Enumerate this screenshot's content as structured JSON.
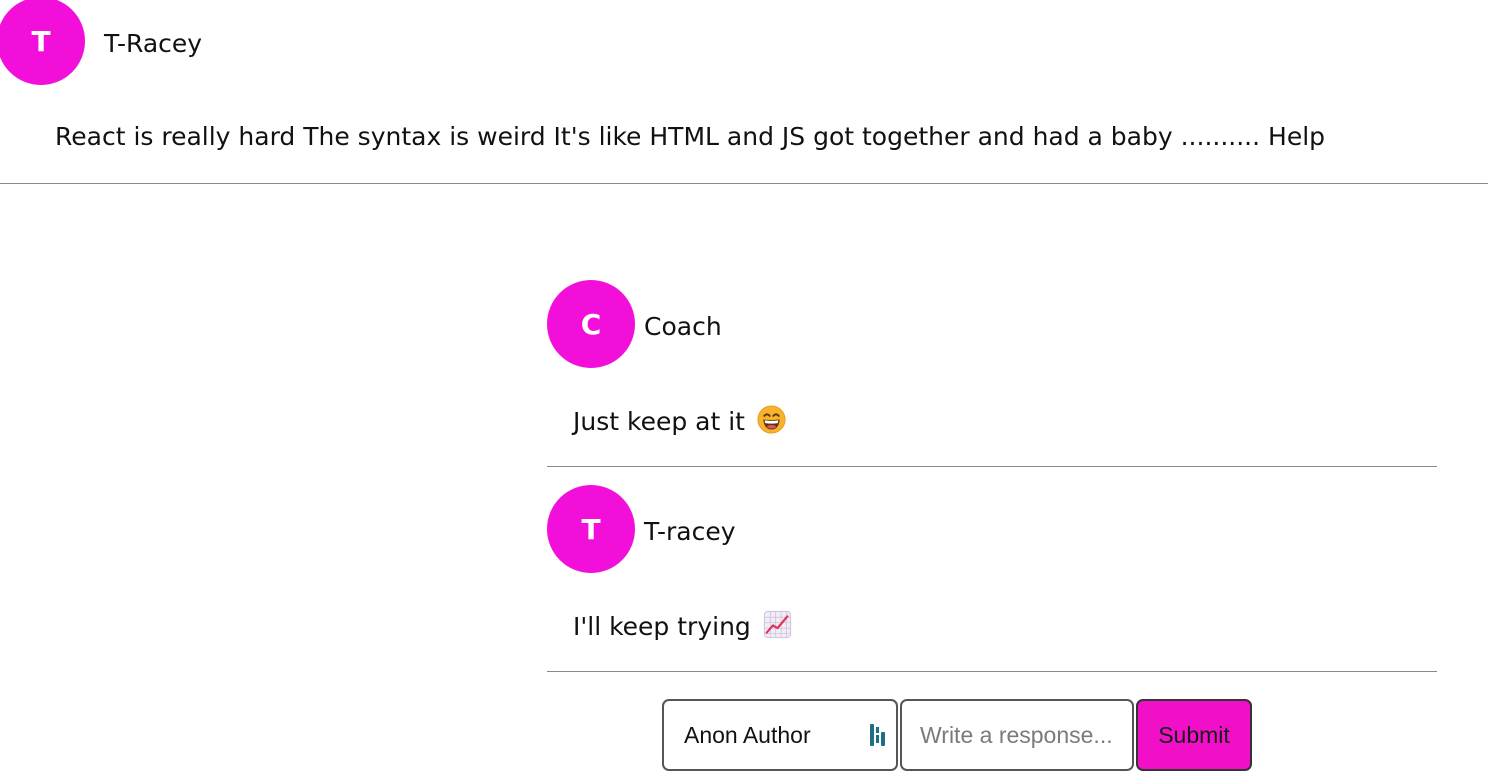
{
  "post": {
    "avatar_initial": "T",
    "author": "T-Racey",
    "text": "React is really hard The syntax is weird It's like HTML and JS got together and had a baby .......... Help"
  },
  "replies": [
    {
      "avatar_initial": "C",
      "author": "Coach",
      "text": "Just keep at it",
      "emoji": "grinning-face-with-smiling-eyes-icon"
    },
    {
      "avatar_initial": "T",
      "author": "T-racey",
      "text": "I'll keep trying",
      "emoji": "chart-increasing-icon"
    }
  ],
  "form": {
    "author_value": "Anon Author",
    "response_placeholder": "Write a response...",
    "submit_label": "Submit"
  },
  "colors": {
    "avatar": "#f20fda",
    "submit": "#f20fc8"
  }
}
